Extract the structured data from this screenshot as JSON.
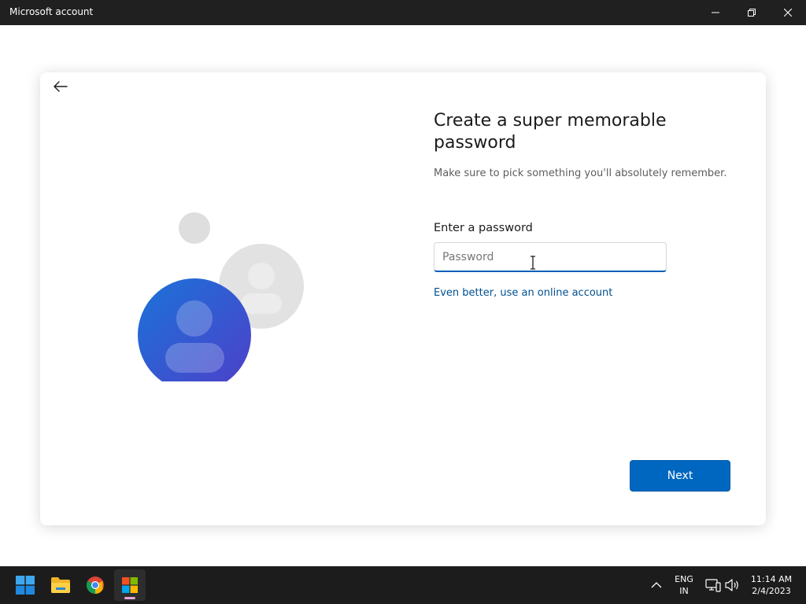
{
  "window": {
    "title": "Microsoft account",
    "controls": [
      "minimize",
      "maximize",
      "close"
    ]
  },
  "page": {
    "back_icon": "arrow-left-icon",
    "heading": "Create a super memorable password",
    "subtext": "Make sure to pick something you'll absolutely remember.",
    "password_label": "Enter a password",
    "password_placeholder": "Password",
    "password_value": "",
    "online_link": "Even better, use an online account",
    "next_button": "Next"
  },
  "colors": {
    "accent": "#0067c0",
    "link": "#00508f",
    "titlebar": "#202020",
    "taskbar": "#1c1c1c"
  },
  "taskbar": {
    "pinned": [
      "windows-start-icon",
      "file-explorer-icon",
      "chrome-icon",
      "microsoft-store-icon"
    ],
    "active": "microsoft-store-icon",
    "language_line1": "ENG",
    "language_line2": "IN",
    "time": "11:14 AM",
    "date": "2/4/2023"
  }
}
